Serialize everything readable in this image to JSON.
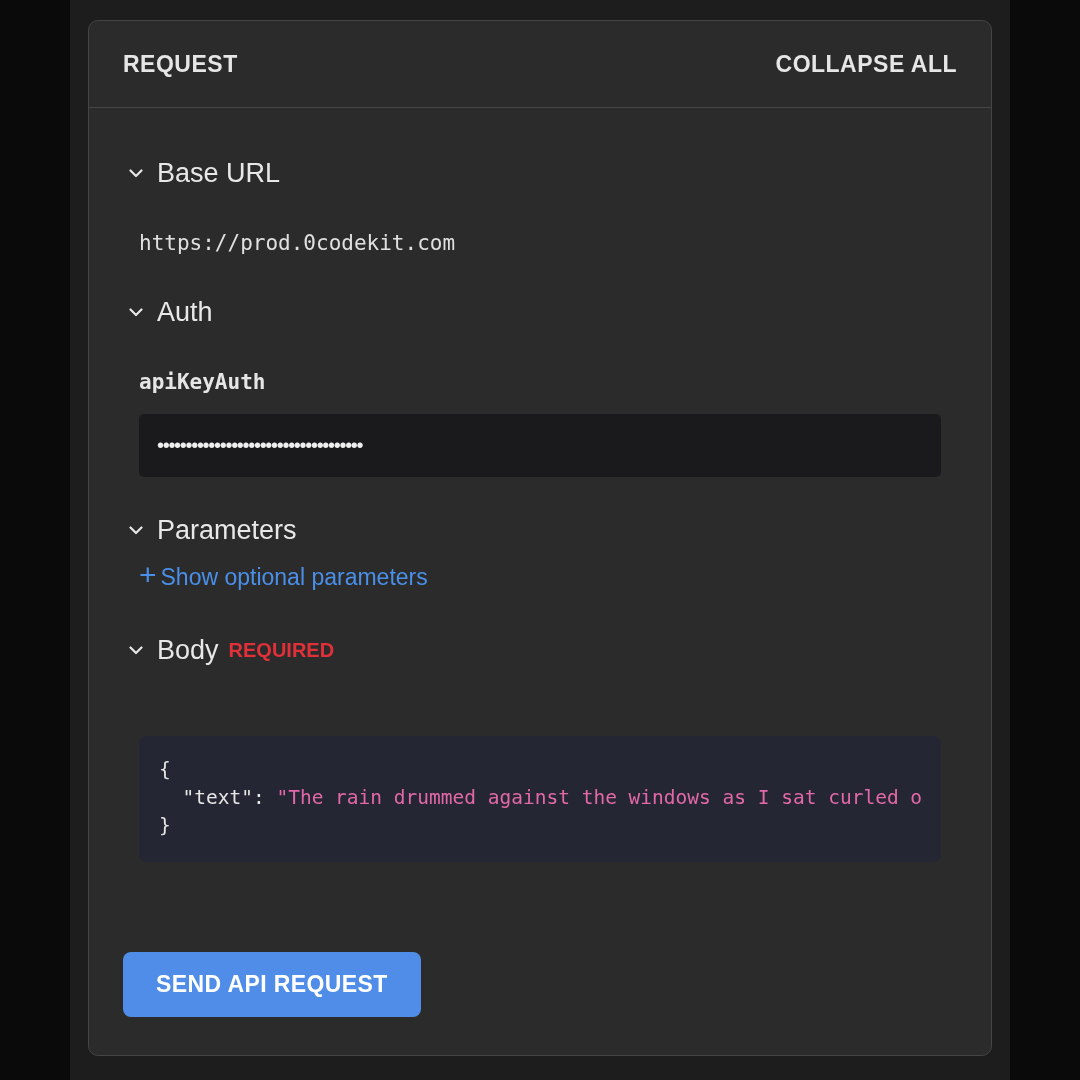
{
  "panel": {
    "title": "REQUEST",
    "collapse_all": "COLLAPSE ALL"
  },
  "sections": [
    {
      "kind": "url",
      "title": "Base URL",
      "expanded": true,
      "value": "https://prod.0codekit.com"
    },
    {
      "kind": "auth",
      "title": "Auth",
      "expanded": true,
      "label": "apiKeyAuth",
      "value": "••••••••••••••••••••••••••••••••••••"
    },
    {
      "kind": "params",
      "title": "Parameters",
      "expanded": true,
      "link_icon": "+",
      "link": "Show optional parameters"
    },
    {
      "kind": "body",
      "title": "Body",
      "expanded": true,
      "badge": "REQUIRED",
      "code": {
        "open": "{",
        "key": "\"text\"",
        "colon": ":",
        "value": "\"The rain drummed against the windows as I sat curled o",
        "close": "}"
      }
    }
  ],
  "send_button": "SEND API REQUEST"
}
